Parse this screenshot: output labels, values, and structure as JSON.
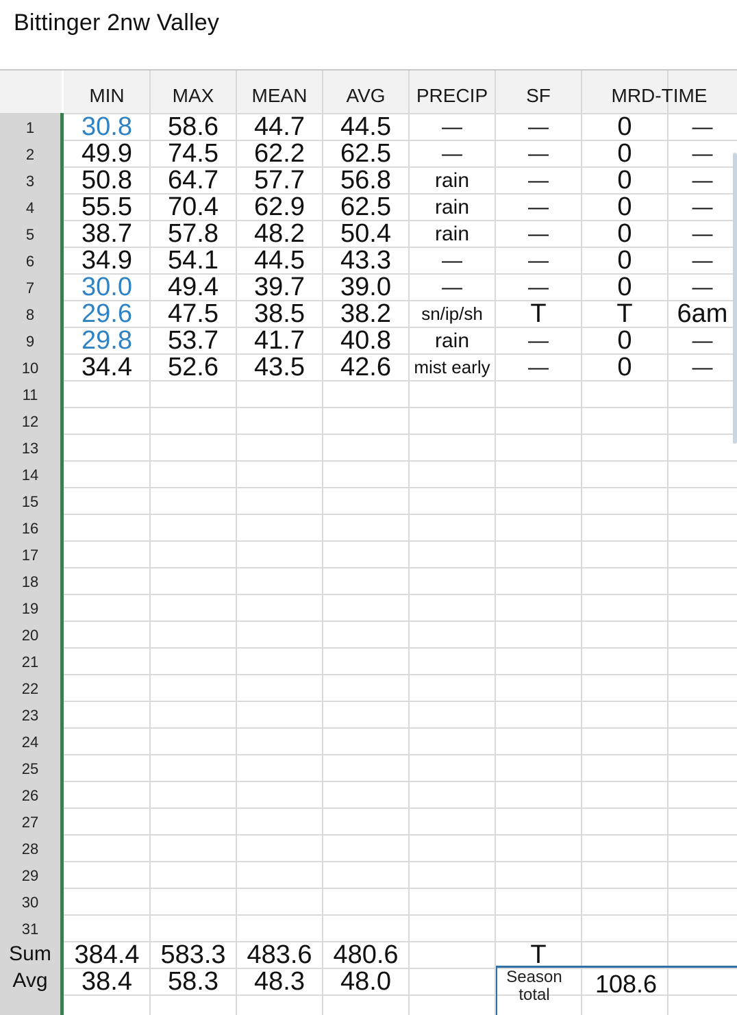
{
  "title": "Bittinger 2nw Valley",
  "columns": [
    "MIN",
    "MAX",
    "MEAN",
    "AVG",
    "PRECIP",
    "SF",
    "MRD-TIME"
  ],
  "row_numbers": [
    "1",
    "2",
    "3",
    "4",
    "5",
    "6",
    "7",
    "8",
    "9",
    "10",
    "11",
    "12",
    "13",
    "14",
    "15",
    "16",
    "17",
    "18",
    "19",
    "20",
    "21",
    "22",
    "23",
    "24",
    "25",
    "26",
    "27",
    "28",
    "29",
    "30",
    "31"
  ],
  "rows": [
    {
      "min": "30.8",
      "min_blue": true,
      "max": "58.6",
      "mean": "44.7",
      "avg": "44.5",
      "precip": "—",
      "sf": "—",
      "mrd": "0",
      "time": "—"
    },
    {
      "min": "49.9",
      "min_blue": false,
      "max": "74.5",
      "mean": "62.2",
      "avg": "62.5",
      "precip": "—",
      "sf": "—",
      "mrd": "0",
      "time": "—"
    },
    {
      "min": "50.8",
      "min_blue": false,
      "max": "64.7",
      "mean": "57.7",
      "avg": "56.8",
      "precip": "rain",
      "sf": "—",
      "mrd": "0",
      "time": "—"
    },
    {
      "min": "55.5",
      "min_blue": false,
      "max": "70.4",
      "mean": "62.9",
      "avg": "62.5",
      "precip": "rain",
      "sf": "—",
      "mrd": "0",
      "time": "—"
    },
    {
      "min": "38.7",
      "min_blue": false,
      "max": "57.8",
      "mean": "48.2",
      "avg": "50.4",
      "precip": "rain",
      "sf": "—",
      "mrd": "0",
      "time": "—"
    },
    {
      "min": "34.9",
      "min_blue": false,
      "max": "54.1",
      "mean": "44.5",
      "avg": "43.3",
      "precip": "—",
      "sf": "—",
      "mrd": "0",
      "time": "—"
    },
    {
      "min": "30.0",
      "min_blue": true,
      "max": "49.4",
      "mean": "39.7",
      "avg": "39.0",
      "precip": "—",
      "sf": "—",
      "mrd": "0",
      "time": "—"
    },
    {
      "min": "29.6",
      "min_blue": true,
      "max": "47.5",
      "mean": "38.5",
      "avg": "38.2",
      "precip": "sn/ip/sh",
      "sf": "T",
      "mrd": "T",
      "time": "6am"
    },
    {
      "min": "29.8",
      "min_blue": true,
      "max": "53.7",
      "mean": "41.7",
      "avg": "40.8",
      "precip": "rain",
      "sf": "—",
      "mrd": "0",
      "time": "—"
    },
    {
      "min": "34.4",
      "min_blue": false,
      "max": "52.6",
      "mean": "43.5",
      "avg": "42.6",
      "precip": "mist early",
      "sf": "—",
      "mrd": "0",
      "time": "—"
    }
  ],
  "sum": {
    "label": "Sum",
    "min": "384.4",
    "max": "583.3",
    "mean": "483.6",
    "avg": "480.6",
    "sf": "T"
  },
  "avg_row": {
    "label": "Avg",
    "min": "38.4",
    "max": "58.3",
    "mean": "48.3",
    "avg": "48.0"
  },
  "season": {
    "label": "Season total",
    "value": "108.6"
  },
  "colors": {
    "blue_value": "#2f83c4",
    "green_bar": "#3e7e4e",
    "row_header_bg": "#d6d6d6",
    "header_bg": "#f2f2f2",
    "season_border": "#2f6fa8"
  }
}
